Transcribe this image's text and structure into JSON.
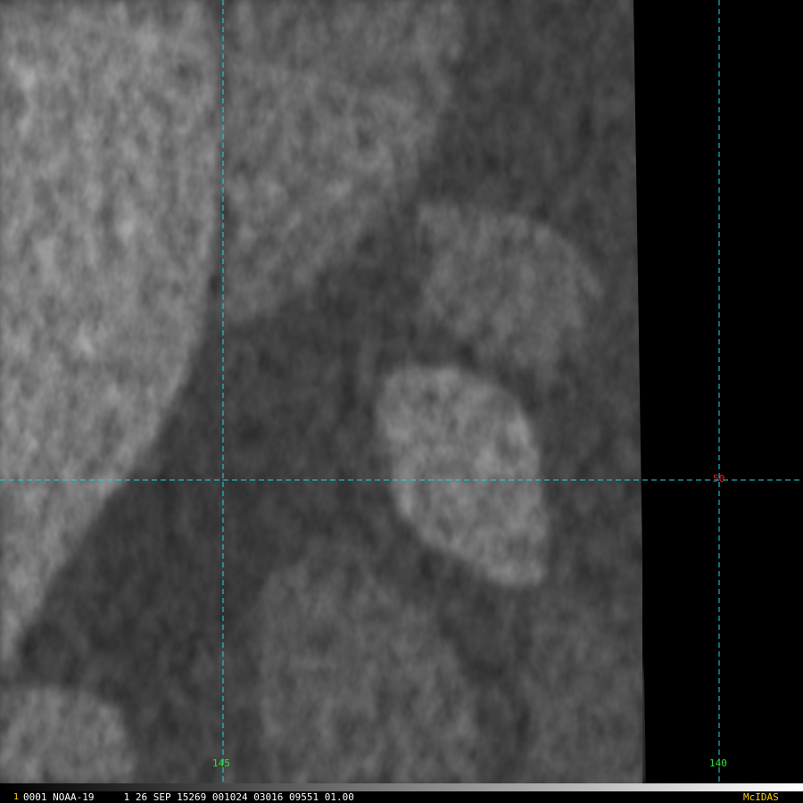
{
  "colors": {
    "grid": "#22d3e0",
    "lat_label": "#e0282d",
    "lon_label": "#39e039",
    "status_text": "#ffffff",
    "frame_number": "#ffd400",
    "brand": "#ffd400",
    "no_data": "#000000"
  },
  "grid": {
    "latitude_labels": [
      "50"
    ],
    "longitude_labels": [
      "145",
      "140"
    ]
  },
  "status": {
    "frame_number": "1",
    "text": "0001 NOAA-19     1 26 SEP 15269 001024 03016 09551 01.00",
    "brand": "McIDAS"
  }
}
